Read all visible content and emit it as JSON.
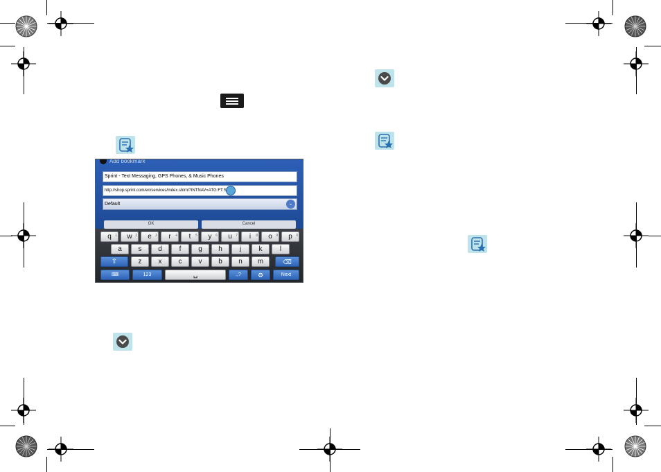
{
  "phone_screenshot": {
    "dialog_title": "Add bookmark",
    "name_field": "Sprint - Text Messaging, GPS Phones, & Music Phones",
    "url_field": "http://shop.sprint.com/en/services/index.shtml?INTNAV=ATG:FT:Svcs",
    "folder_select": "Default",
    "ok_button": "OK",
    "cancel_button": "Cancel",
    "keyboard": {
      "row1": [
        "q",
        "w",
        "e",
        "r",
        "t",
        "y",
        "u",
        "i",
        "o",
        "p"
      ],
      "row1_numbers": [
        "1",
        "2",
        "3",
        "4",
        "5",
        "6",
        "7",
        "8",
        "9",
        "0"
      ],
      "row2": [
        "a",
        "s",
        "d",
        "f",
        "g",
        "h",
        "j",
        "k",
        "l"
      ],
      "row3": [
        "z",
        "x",
        "c",
        "v",
        "b",
        "n",
        "m"
      ],
      "numbers_key": "123",
      "symbols_key": ".,?",
      "next_key": "Next"
    }
  },
  "icons": {
    "menu_key": "menu-key-icon",
    "bookmark_star": "bookmark-star-icon",
    "chevron_down": "chevron-down-icon",
    "registration": "registration-mark-icon"
  },
  "colors": {
    "icon_background": "#bfe3ea",
    "dialog_blue": "#2c5fb6",
    "key_blue": "#3f74c6"
  }
}
